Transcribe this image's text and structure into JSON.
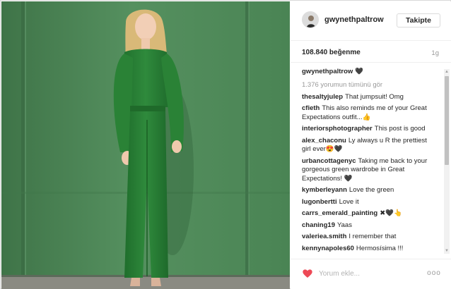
{
  "post": {
    "username": "gwynethpaltrow",
    "follow_label": "Takipte",
    "likes": "108.840 beğenme",
    "time_ago": "1g",
    "caption": {
      "user": "gwynethpaltrow",
      "text": "🖤"
    },
    "view_all_comments": "1.376 yorumun tümünü gör",
    "comments": [
      {
        "user": "thesaltyjulep",
        "text": "That jumpsuit! Omg"
      },
      {
        "user": "cfieth",
        "text": "This also reminds me of your Great Expectations outfit...👍"
      },
      {
        "user": "interiorsphotographer",
        "text": "This post is good"
      },
      {
        "user": "alex_chaconu",
        "text": "Ly always u R the prettiest girl ever😍🖤"
      },
      {
        "user": "urbancottagenyc",
        "text": "Taking me back to your gorgeous green wardrobe in Great Expectations! 🖤"
      },
      {
        "user": "kymberleyann",
        "text": "Love the green"
      },
      {
        "user": "lugonbertti",
        "text": "Love it"
      },
      {
        "user": "carrs_emerald_painting",
        "text": "✖🖤👆"
      },
      {
        "user": "chaning19",
        "text": "Yaas"
      },
      {
        "user": "valeriea.smith",
        "text": "I remember that"
      },
      {
        "user": "kennynapoles60",
        "text": "Hermosísima !!!"
      }
    ],
    "comment_placeholder": "Yorum ekle...",
    "more_label": "ooo",
    "colors": {
      "heart": "#ed4956",
      "wall": "#4e8358",
      "outfit": "#2f8a3c"
    }
  }
}
